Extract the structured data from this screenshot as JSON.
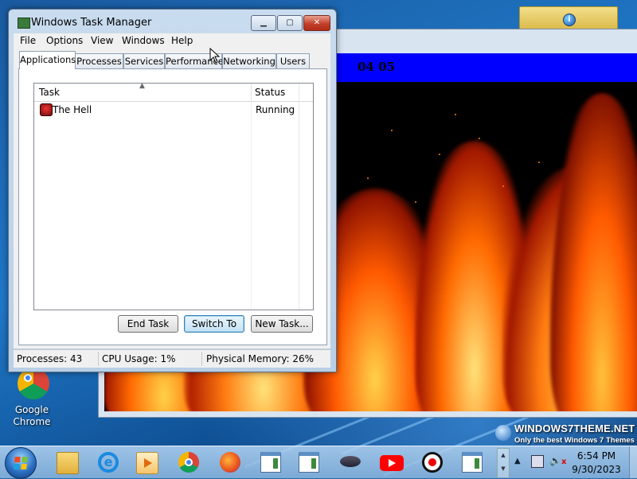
{
  "taskmgr": {
    "title": "Windows Task Manager",
    "caption_buttons": {
      "minimize": "▁",
      "maximize": "▢",
      "close": "✕"
    },
    "menu": [
      "File",
      "Options",
      "View",
      "Windows",
      "Help"
    ],
    "tabs": [
      "Applications",
      "Processes",
      "Services",
      "Performance",
      "Networking",
      "Users"
    ],
    "active_tab": "Applications",
    "columns": {
      "task": "Task",
      "status": "Status"
    },
    "rows": [
      {
        "name": "The Hell",
        "status": "Running",
        "icon": "app-icon"
      }
    ],
    "buttons": {
      "end_task": "End Task",
      "switch_to": "Switch To",
      "new_task": "New Task..."
    },
    "status": {
      "processes": "Processes: 43",
      "cpu": "CPU Usage: 1%",
      "memory": "Physical Memory: 26%"
    }
  },
  "game_window": {
    "timer": "04 05"
  },
  "desktop": {
    "icons": [
      {
        "label": "Google Chrome",
        "icon": "chrome-icon"
      }
    ],
    "watermark": {
      "title": "WINDOWS7THEME.NET",
      "subtitle": "Only the best Windows 7 Themes"
    }
  },
  "taskbar": {
    "pinned": [
      "folder-icon",
      "internet-explorer-icon",
      "media-player-icon",
      "chrome-icon",
      "firefox-icon",
      "window-app-icon",
      "window-app-icon",
      "ufo-game-icon",
      "youtube-icon",
      "record-icon",
      "window-app-icon"
    ],
    "clock": {
      "time": "6:54 PM",
      "date": "9/30/2023"
    },
    "tray": [
      "tray-expand-icon",
      "network-icon",
      "volume-muted-icon"
    ]
  },
  "colors": {
    "game_bar": "#0000ff",
    "close_button": "#c2402a",
    "taskbar": "#8cb4dc"
  }
}
